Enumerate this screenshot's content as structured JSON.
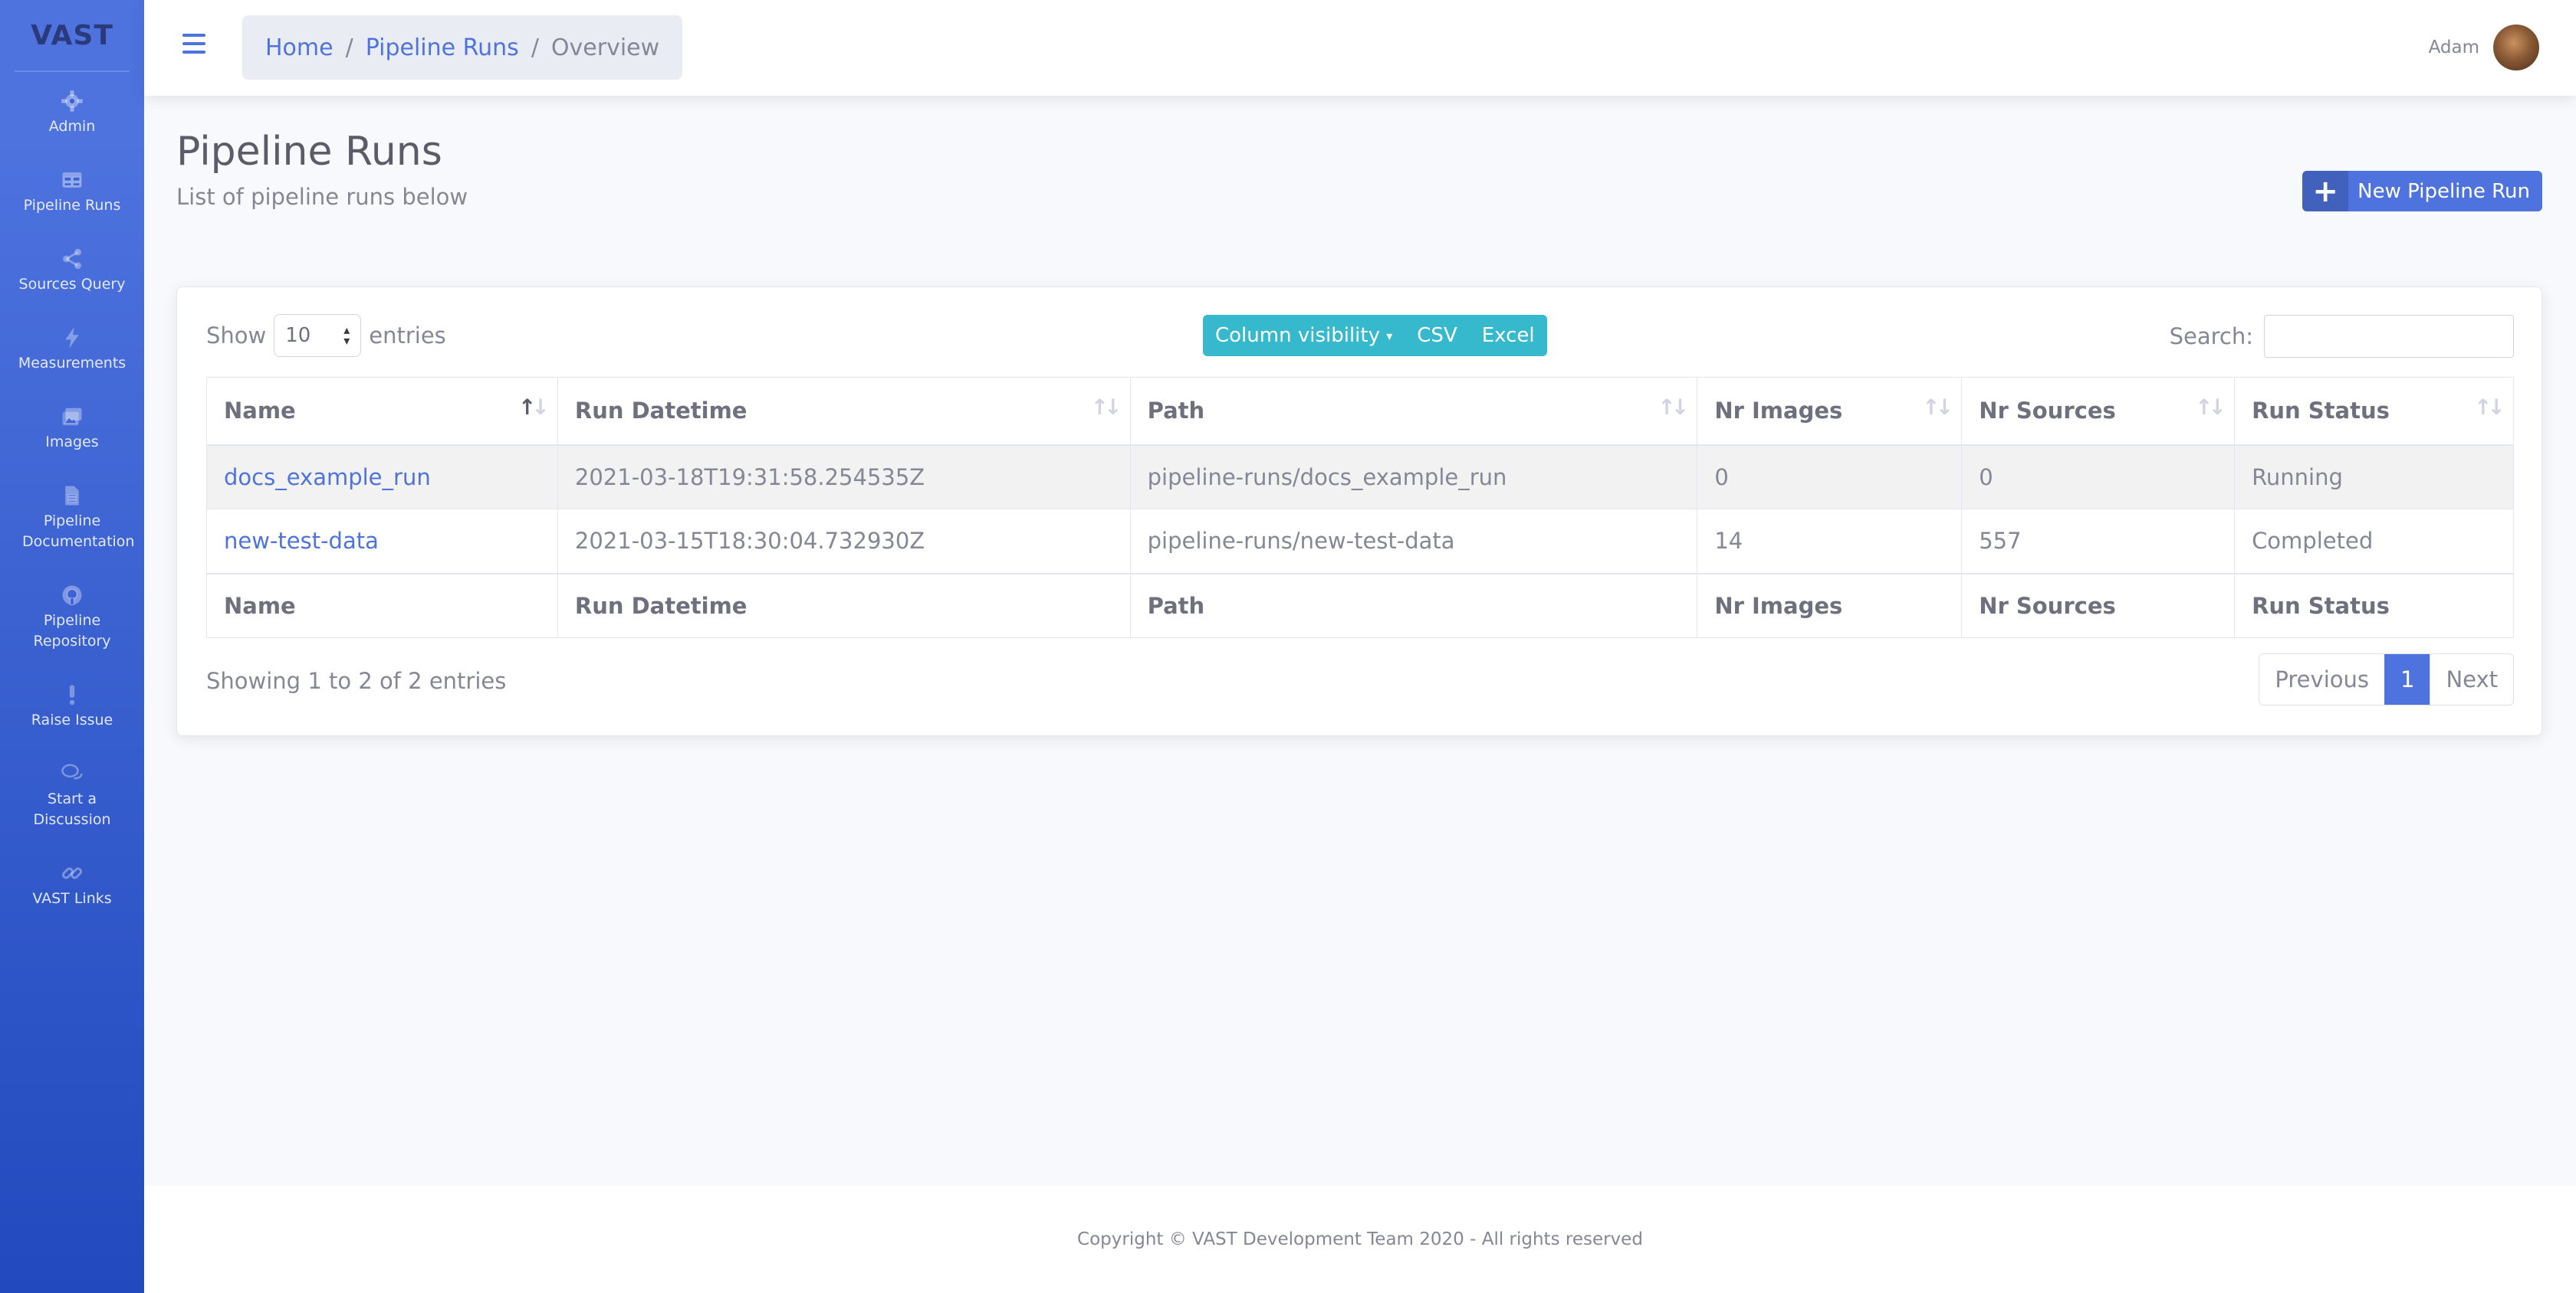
{
  "sidebar": {
    "brand": "VAST",
    "items": [
      {
        "icon": "gear-icon",
        "label": "Admin"
      },
      {
        "icon": "table-icon",
        "label": "Pipeline Runs"
      },
      {
        "icon": "share-icon",
        "label": "Sources Query"
      },
      {
        "icon": "bolt-icon",
        "label": "Measurements"
      },
      {
        "icon": "images-icon",
        "label": "Images"
      },
      {
        "icon": "file-icon",
        "label": "Pipeline Documentation"
      },
      {
        "icon": "github-icon",
        "label": "Pipeline Repository"
      },
      {
        "icon": "exclamation-icon",
        "label": "Raise Issue"
      },
      {
        "icon": "comments-icon",
        "label": "Start a Discussion"
      },
      {
        "icon": "link-icon",
        "label": "VAST Links"
      }
    ]
  },
  "topbar": {
    "breadcrumb": {
      "home": "Home",
      "section": "Pipeline Runs",
      "current": "Overview",
      "separator": "/"
    },
    "user_name": "Adam"
  },
  "page": {
    "title": "Pipeline Runs",
    "subtitle": "List of pipeline runs below",
    "new_button_label": "New Pipeline Run"
  },
  "table_controls": {
    "show_label": "Show",
    "entries_label": "entries",
    "page_length": "10",
    "buttons": [
      "Column visibility",
      "CSV",
      "Excel"
    ],
    "search_label": "Search:",
    "search_value": ""
  },
  "table": {
    "columns": [
      "Name",
      "Run Datetime",
      "Path",
      "Nr Images",
      "Nr Sources",
      "Run Status"
    ],
    "sorted_column": "Name",
    "sort_direction": "ascending",
    "rows": [
      {
        "name": "docs_example_run",
        "datetime": "2021-03-18T19:31:58.254535Z",
        "path": "pipeline-runs/docs_example_run",
        "nr_images": "0",
        "nr_sources": "0",
        "status": "Running"
      },
      {
        "name": "new-test-data",
        "datetime": "2021-03-15T18:30:04.732930Z",
        "path": "pipeline-runs/new-test-data",
        "nr_images": "14",
        "nr_sources": "557",
        "status": "Completed"
      }
    ]
  },
  "pagination": {
    "info": "Showing 1 to 2 of 2 entries",
    "previous": "Previous",
    "current_page": "1",
    "next": "Next"
  },
  "footer": {
    "text": "Copyright © VAST Development Team 2020 - All rights reserved"
  },
  "colors": {
    "primary": "#4e73df",
    "info": "#36b9cc",
    "text": "#858796"
  }
}
